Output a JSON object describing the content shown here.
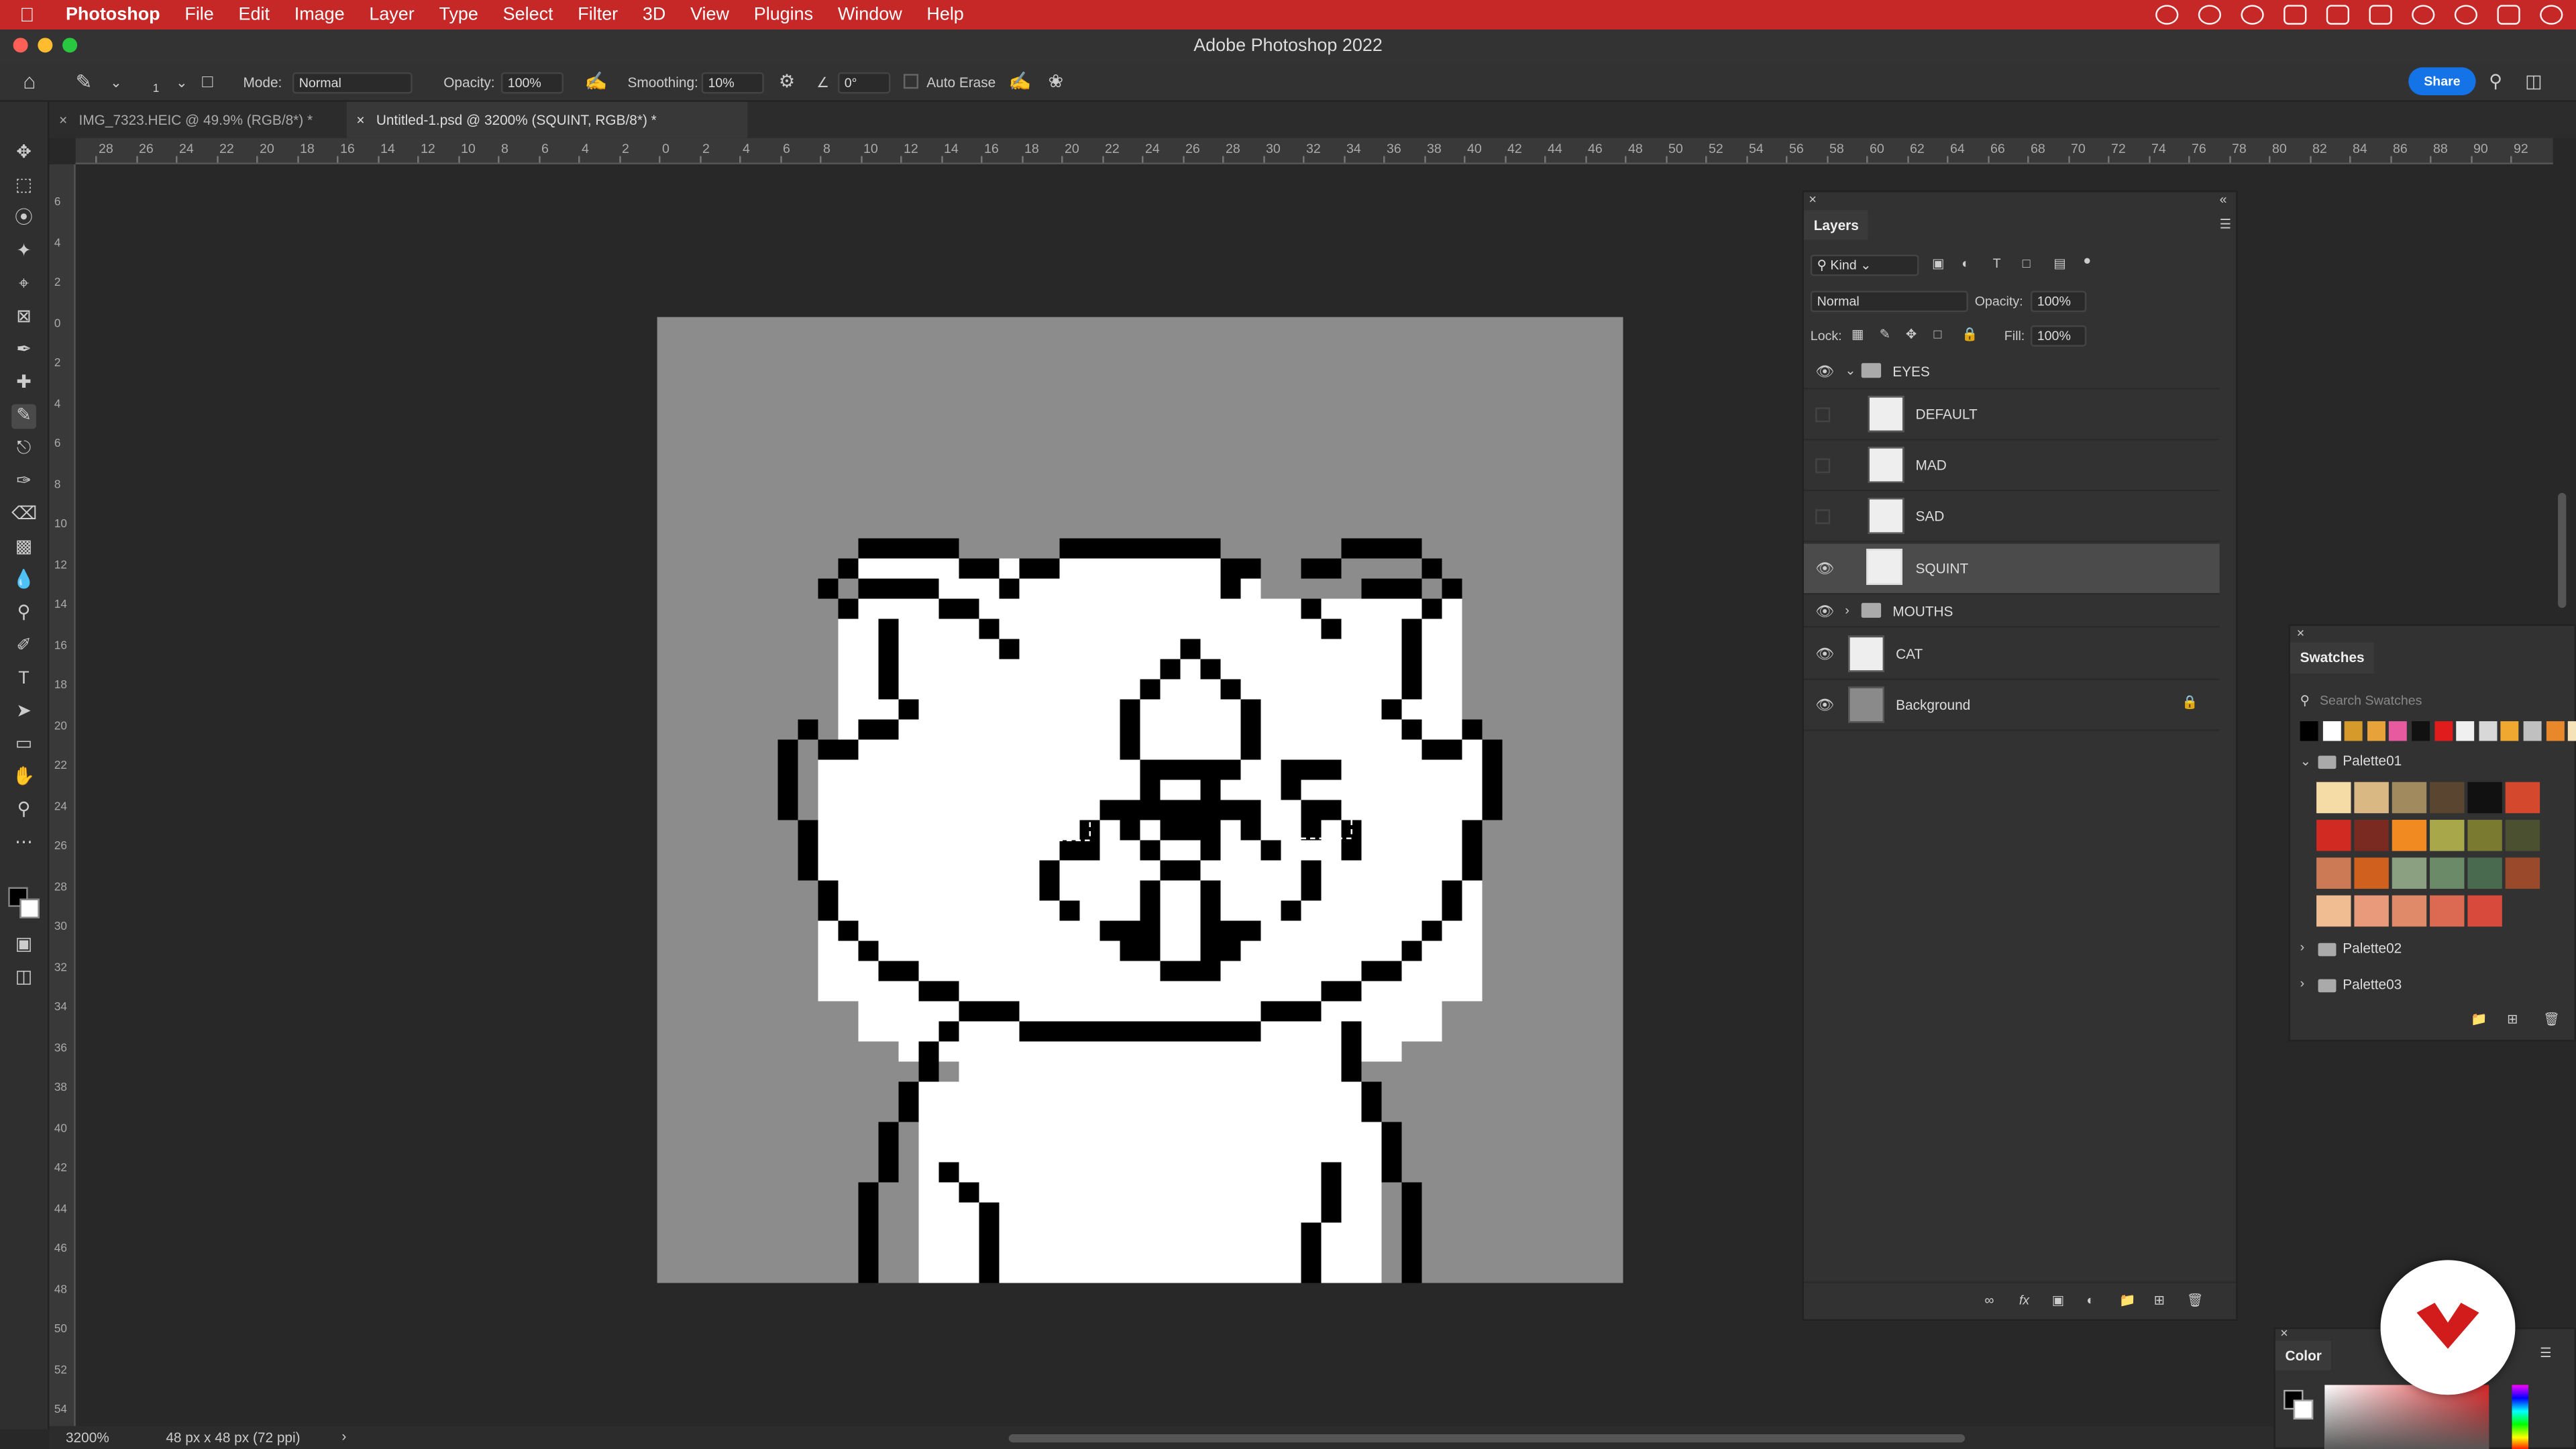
{
  "menubar": {
    "app_name": "Photoshop",
    "items": [
      "File",
      "Edit",
      "Image",
      "Layer",
      "Type",
      "Select",
      "Filter",
      "3D",
      "View",
      "Plugins",
      "Window",
      "Help"
    ]
  },
  "window": {
    "title": "Adobe Photoshop 2022"
  },
  "options": {
    "mode_label": "Mode:",
    "mode_value": "Normal",
    "opacity_label": "Opacity:",
    "opacity_value": "100%",
    "smoothing_label": "Smoothing:",
    "smoothing_value": "10%",
    "angle_value": "0°",
    "auto_erase_label": "Auto Erase",
    "brush_size": "1",
    "share_label": "Share"
  },
  "tabs": [
    {
      "label": "IMG_7323.HEIC @ 49.9% (RGB/8*) *"
    },
    {
      "label": "Untitled-1.psd @ 3200% (SQUINT, RGB/8*) *"
    }
  ],
  "ruler": {
    "top_labels": [
      "28",
      "26",
      "24",
      "22",
      "20",
      "18",
      "16",
      "14",
      "12",
      "10",
      "8",
      "6",
      "4",
      "2",
      "0",
      "2",
      "4",
      "6",
      "8",
      "10",
      "12",
      "14",
      "16",
      "18",
      "20",
      "22",
      "24",
      "26",
      "28",
      "30",
      "32",
      "34",
      "36",
      "38",
      "40",
      "42",
      "44",
      "46",
      "48",
      "50",
      "52",
      "54",
      "56",
      "58",
      "60",
      "62",
      "64",
      "66",
      "68",
      "70",
      "72",
      "74",
      "76",
      "78",
      "80",
      "82",
      "84",
      "86",
      "88",
      "90",
      "92"
    ],
    "left_labels": [
      "6",
      "4",
      "2",
      "0",
      "2",
      "4",
      "6",
      "8",
      "10",
      "12",
      "14",
      "16",
      "18",
      "20",
      "22",
      "24",
      "26",
      "28",
      "30",
      "32",
      "34",
      "36",
      "38",
      "40",
      "42",
      "44",
      "46",
      "48",
      "50",
      "52",
      "54"
    ]
  },
  "status": {
    "zoom": "3200%",
    "doc_info": "48 px x 48 px (72 ppi)"
  },
  "layers": {
    "tab": "Layers",
    "kind_label": "Kind",
    "blend_mode": "Normal",
    "opacity_label": "Opacity:",
    "opacity_value": "100%",
    "lock_label": "Lock:",
    "fill_label": "Fill:",
    "fill_value": "100%",
    "items": [
      {
        "name": "EYES",
        "visible": true,
        "type": "group"
      },
      {
        "name": "DEFAULT",
        "visible": false,
        "type": "layer"
      },
      {
        "name": "MAD",
        "visible": false,
        "type": "layer"
      },
      {
        "name": "SAD",
        "visible": false,
        "type": "layer"
      },
      {
        "name": "SQUINT",
        "visible": true,
        "type": "layer",
        "selected": true
      },
      {
        "name": "MOUTHS",
        "visible": true,
        "type": "group"
      },
      {
        "name": "CAT",
        "visible": true,
        "type": "layer"
      },
      {
        "name": "Background",
        "visible": true,
        "type": "layer",
        "locked": true
      }
    ]
  },
  "swatches": {
    "tab": "Swatches",
    "search_placeholder": "Search Swatches",
    "recent": [
      "#000000",
      "#ffffff",
      "#d69a2a",
      "#e8a23a",
      "#e75aa0",
      "#111111",
      "#e01c1c",
      "#f0f0f0",
      "#d8d8d8",
      "#f0a830",
      "#c0c0c0",
      "#e8882a",
      "#f6e2b8"
    ],
    "palettes": [
      {
        "name": "Palette01",
        "colors": [
          "#f5dca6",
          "#d9b883",
          "#a08a5e",
          "#5a4630",
          "#111111",
          "#d4482e",
          "#d02a22",
          "#7a2a20",
          "#f28a22",
          "#a8a84a",
          "#7a7a30",
          "#4a5030",
          "#cc7a55",
          "#d0601e",
          "#8aa080",
          "#6a8a68",
          "#4a6a50",
          "#9a4a2a",
          "#f0bc92",
          "#e89a7a",
          "#e08a6a",
          "#dc6a52",
          "#d84a3c"
        ]
      },
      {
        "name": "Palette02",
        "colors": []
      },
      {
        "name": "Palette03",
        "colors": []
      }
    ]
  },
  "color_panel": {
    "tab": "Color"
  },
  "accent": "#c62828"
}
